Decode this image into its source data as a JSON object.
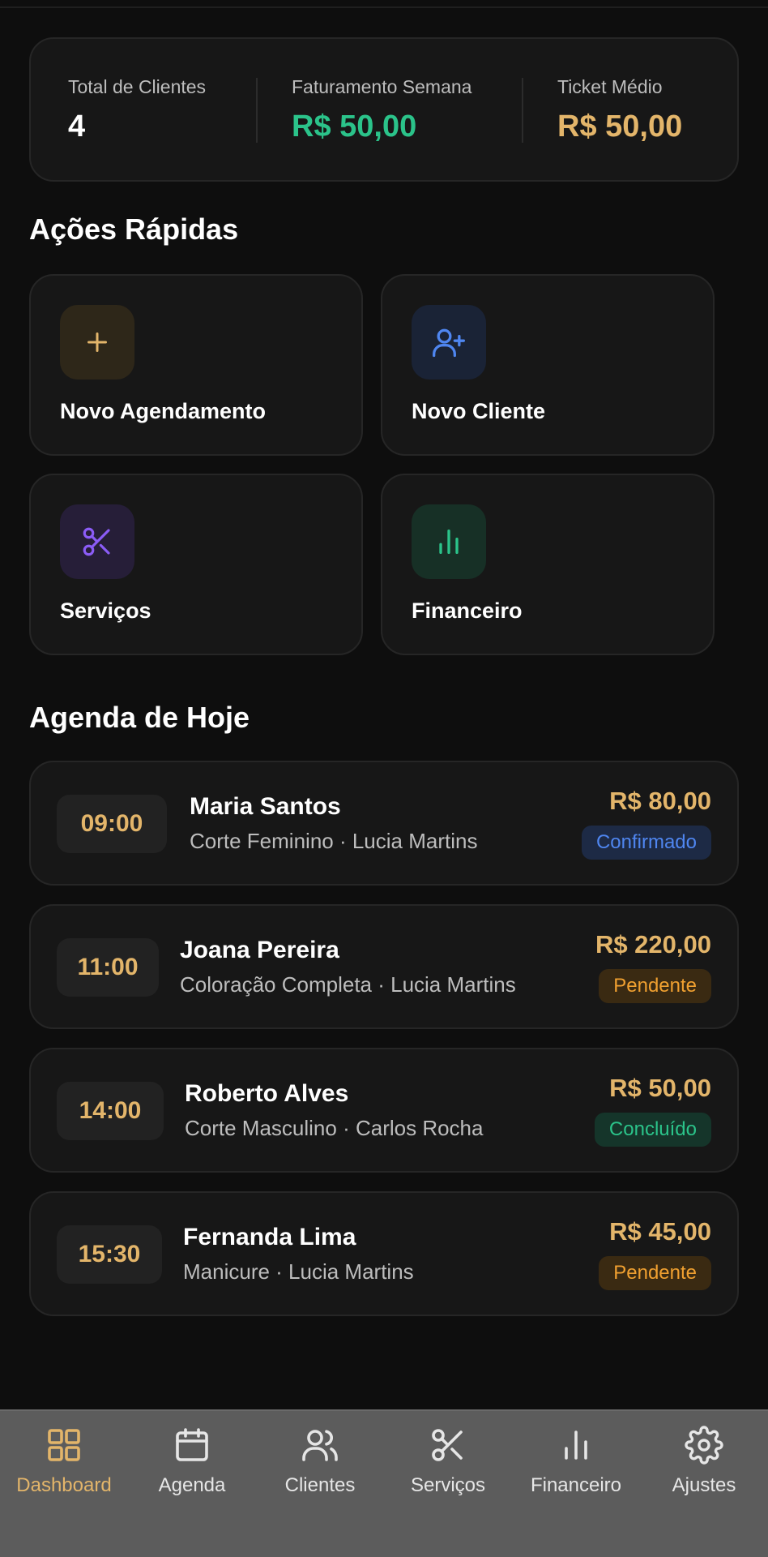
{
  "stats": {
    "clients_label": "Total de Clientes",
    "clients_value": "4",
    "revenue_label": "Faturamento Semana",
    "revenue_value": "R$ 50,00",
    "ticket_label": "Ticket Médio",
    "ticket_value": "R$ 50,00"
  },
  "quick_actions": {
    "title": "Ações Rápidas",
    "items": [
      {
        "label": "Novo Agendamento",
        "icon": "plus-icon"
      },
      {
        "label": "Novo Cliente",
        "icon": "user-plus-icon"
      },
      {
        "label": "Serviços",
        "icon": "scissors-icon"
      },
      {
        "label": "Financeiro",
        "icon": "bar-chart-icon"
      }
    ]
  },
  "agenda": {
    "title": "Agenda de Hoje",
    "items": [
      {
        "time": "09:00",
        "client": "Maria Santos",
        "detail": "Corte Feminino · Lucia Martins",
        "price": "R$ 80,00",
        "status": "Confirmado"
      },
      {
        "time": "11:00",
        "client": "Joana Pereira",
        "detail": "Coloração Completa · Lucia Martins",
        "price": "R$ 220,00",
        "status": "Pendente"
      },
      {
        "time": "14:00",
        "client": "Roberto Alves",
        "detail": "Corte Masculino · Carlos Rocha",
        "price": "R$ 50,00",
        "status": "Concluído"
      },
      {
        "time": "15:30",
        "client": "Fernanda Lima",
        "detail": "Manicure · Lucia Martins",
        "price": "R$ 45,00",
        "status": "Pendente"
      }
    ]
  },
  "nav": {
    "items": [
      {
        "label": "Dashboard",
        "icon": "grid-icon",
        "active": true
      },
      {
        "label": "Agenda",
        "icon": "calendar-icon"
      },
      {
        "label": "Clientes",
        "icon": "users-icon"
      },
      {
        "label": "Serviços",
        "icon": "scissors-icon"
      },
      {
        "label": "Financeiro",
        "icon": "bar-chart-icon"
      },
      {
        "label": "Ajustes",
        "icon": "gear-icon"
      }
    ]
  },
  "colors": {
    "accent_gold": "#e3b56a",
    "green": "#2bc38a",
    "blue": "#4f86f0",
    "purple": "#8b5cf6",
    "orange": "#f0a030",
    "background": "#0e0e0e",
    "card": "#171717"
  }
}
